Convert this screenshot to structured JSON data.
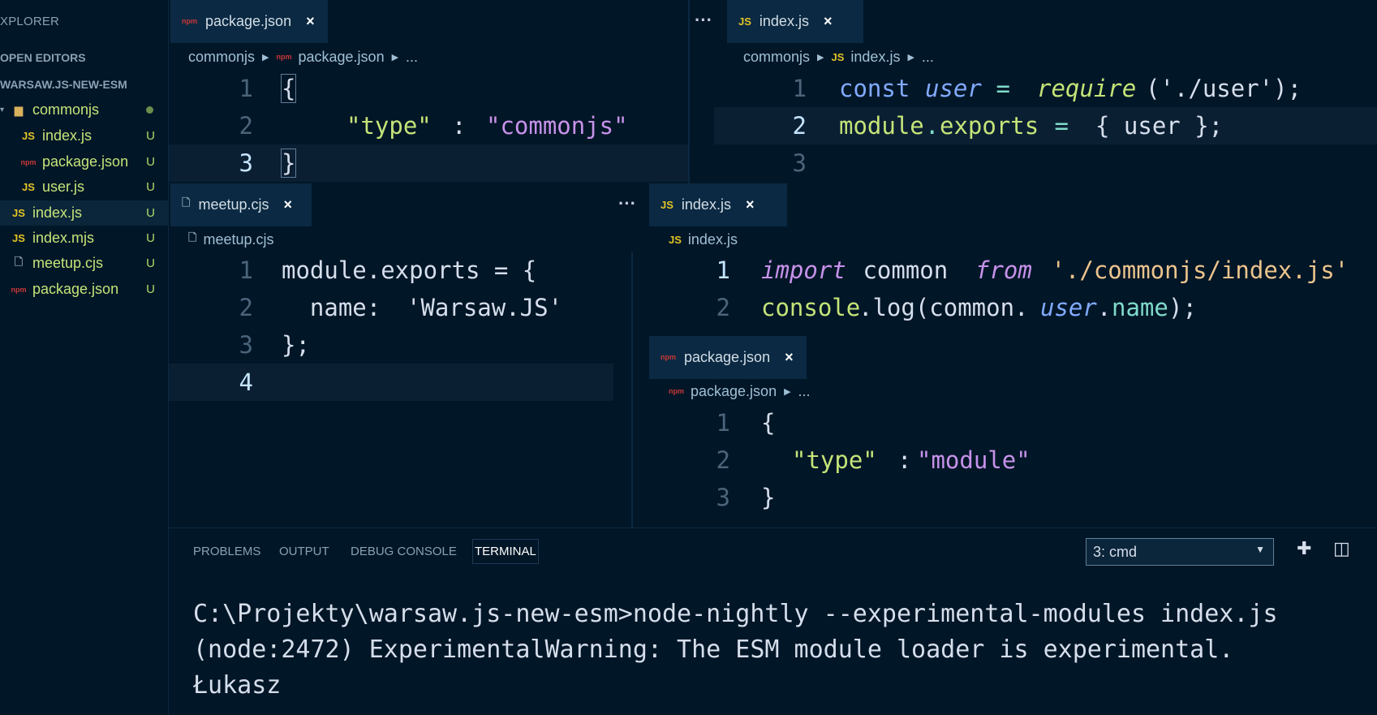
{
  "sidebar": {
    "title": "XPLORER",
    "open_editors": "OPEN EDITORS",
    "project": "WARSAW.JS-NEW-ESM",
    "items": [
      {
        "label": "commonjs",
        "badge": ""
      },
      {
        "label": "index.js",
        "badge": "U"
      },
      {
        "label": "package.json",
        "badge": "U"
      },
      {
        "label": "user.js",
        "badge": "U"
      },
      {
        "label": "index.js",
        "badge": "U"
      },
      {
        "label": "index.mjs",
        "badge": "U"
      },
      {
        "label": "meetup.cjs",
        "badge": "U"
      },
      {
        "label": "package.json",
        "badge": "U"
      }
    ],
    "js_icon": "JS",
    "npm_icon": "npm"
  },
  "groups": {
    "g1": {
      "tab": "package.json",
      "crumbs": [
        "commonjs",
        "package.json",
        "..."
      ],
      "lines": [
        {
          "n": "1",
          "text": "{"
        },
        {
          "n": "2",
          "key": "\"type\"",
          "sep": ": ",
          "val": "\"commonjs\""
        },
        {
          "n": "3",
          "text": "}"
        }
      ]
    },
    "g2": {
      "tab": "index.js",
      "crumbs": [
        "commonjs",
        "index.js",
        "..."
      ],
      "lines": [
        {
          "n": "1",
          "a": "const ",
          "b": "user",
          "c": " = ",
          "d": "require",
          "e": "('./user');"
        },
        {
          "n": "2",
          "a": "module",
          "b": ".",
          "c": "exports",
          "d": " = ",
          "e": "{ user };"
        },
        {
          "n": "3"
        }
      ]
    },
    "g3": {
      "tab": "meetup.cjs",
      "crumbs": [
        "meetup.cjs"
      ],
      "lines": [
        {
          "n": "1",
          "text": "module.exports = {"
        },
        {
          "n": "2",
          "key": "  name: ",
          "val": "'Warsaw.JS'"
        },
        {
          "n": "3",
          "text": "};"
        },
        {
          "n": "4",
          "text": ""
        }
      ]
    },
    "g4": {
      "tab": "index.js",
      "crumbs": [
        "index.js"
      ],
      "lines": [
        {
          "n": "1",
          "a": "import",
          "b": " common ",
          "c": "from",
          "d": " './commonjs/index.js'"
        },
        {
          "n": "2",
          "a": "console",
          "b": ".log(common.",
          "c": "user",
          "d": ".",
          "e": "name",
          "f": ");"
        }
      ]
    },
    "g5": {
      "tab": "package.json",
      "crumbs": [
        "package.json",
        "..."
      ],
      "lines": [
        {
          "n": "1",
          "text": "{"
        },
        {
          "n": "2",
          "key": "\"type\"",
          "sep": ": ",
          "val": "\"module\""
        },
        {
          "n": "3",
          "text": "}"
        }
      ]
    }
  },
  "panel": {
    "tabs": [
      "PROBLEMS",
      "OUTPUT",
      "DEBUG CONSOLE",
      "TERMINAL"
    ],
    "active_tab": "TERMINAL",
    "terminal_select": "3: cmd",
    "terminal_lines": [
      "C:\\Projekty\\warsaw.js-new-esm>node-nightly --experimental-modules index.js",
      "(node:2472) ExperimentalWarning: The ESM module loader is experimental.",
      "Łukasz"
    ]
  },
  "colors": {
    "background": "#011627",
    "accent_green": "#c5e478",
    "string": "#ecc48d",
    "keyword": "#82aaff"
  }
}
